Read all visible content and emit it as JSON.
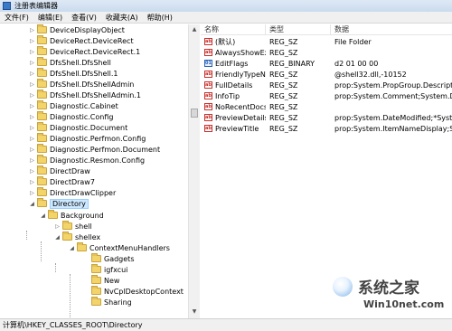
{
  "window": {
    "title": "注册表编辑器",
    "icon": "regedit-icon"
  },
  "menubar": [
    "文件(F)",
    "编辑(E)",
    "查看(V)",
    "收藏夹(A)",
    "帮助(H)"
  ],
  "tree": {
    "items": [
      {
        "label": "DeviceDisplayObject",
        "expander": "▷"
      },
      {
        "label": "DeviceRect.DeviceRect",
        "expander": "▷"
      },
      {
        "label": "DeviceRect.DeviceRect.1",
        "expander": "▷"
      },
      {
        "label": "DfsShell.DfsShell",
        "expander": "▷"
      },
      {
        "label": "DfsShell.DfsShell.1",
        "expander": "▷"
      },
      {
        "label": "DfsShell.DfsShellAdmin",
        "expander": "▷"
      },
      {
        "label": "DfsShell.DfsShellAdmin.1",
        "expander": "▷"
      },
      {
        "label": "Diagnostic.Cabinet",
        "expander": "▷"
      },
      {
        "label": "Diagnostic.Config",
        "expander": "▷"
      },
      {
        "label": "Diagnostic.Document",
        "expander": "▷"
      },
      {
        "label": "Diagnostic.Perfmon.Config",
        "expander": "▷"
      },
      {
        "label": "Diagnostic.Perfmon.Document",
        "expander": "▷"
      },
      {
        "label": "Diagnostic.Resmon.Config",
        "expander": "▷"
      },
      {
        "label": "DirectDraw",
        "expander": "▷"
      },
      {
        "label": "DirectDraw7",
        "expander": "▷"
      },
      {
        "label": "DirectDrawClipper",
        "expander": "▷"
      },
      {
        "label": "Directory",
        "expander": "◢"
      },
      {
        "label": "Background",
        "expander": "◢"
      },
      {
        "label": "shell",
        "expander": "▷"
      },
      {
        "label": "shellex",
        "expander": "◢"
      },
      {
        "label": "ContextMenuHandlers",
        "expander": "◢"
      },
      {
        "label": "Gadgets",
        "expander": ""
      },
      {
        "label": "igfxcui",
        "expander": ""
      },
      {
        "label": "New",
        "expander": ""
      },
      {
        "label": "NvCplDesktopContext",
        "expander": ""
      },
      {
        "label": "Sharing",
        "expander": ""
      }
    ]
  },
  "values": {
    "columns": {
      "name": "名称",
      "type": "类型",
      "data": "数据"
    },
    "rows": [
      {
        "icon": "string-value-icon",
        "badge": "ab",
        "name": "(默认)",
        "type": "REG_SZ",
        "data": "File Folder"
      },
      {
        "icon": "string-value-icon",
        "badge": "ab",
        "name": "AlwaysShowExt",
        "type": "REG_SZ",
        "data": ""
      },
      {
        "icon": "binary-value-icon",
        "badge": "01",
        "name": "EditFlags",
        "type": "REG_BINARY",
        "data": "d2 01 00 00"
      },
      {
        "icon": "string-value-icon",
        "badge": "ab",
        "name": "FriendlyTypeN...",
        "type": "REG_SZ",
        "data": "@shell32.dll,-10152"
      },
      {
        "icon": "string-value-icon",
        "badge": "ab",
        "name": "FullDetails",
        "type": "REG_SZ",
        "data": "prop:System.PropGroup.Description;"
      },
      {
        "icon": "string-value-icon",
        "badge": "ab",
        "name": "InfoTip",
        "type": "REG_SZ",
        "data": "prop:System.Comment;System.DateC"
      },
      {
        "icon": "string-value-icon",
        "badge": "ab",
        "name": "NoRecentDocs",
        "type": "REG_SZ",
        "data": ""
      },
      {
        "icon": "string-value-icon",
        "badge": "ab",
        "name": "PreviewDetails",
        "type": "REG_SZ",
        "data": "prop:System.DateModified;*System.S"
      },
      {
        "icon": "string-value-icon",
        "badge": "ab",
        "name": "PreviewTitle",
        "type": "REG_SZ",
        "data": "prop:System.ItemNameDisplay;Syste"
      }
    ]
  },
  "statusbar": {
    "path": "计算机\\HKEY_CLASSES_ROOT\\Directory"
  },
  "watermark": {
    "title": "系统之家",
    "subtitle": "Win10net.com",
    "logo": "system-home-logo"
  }
}
